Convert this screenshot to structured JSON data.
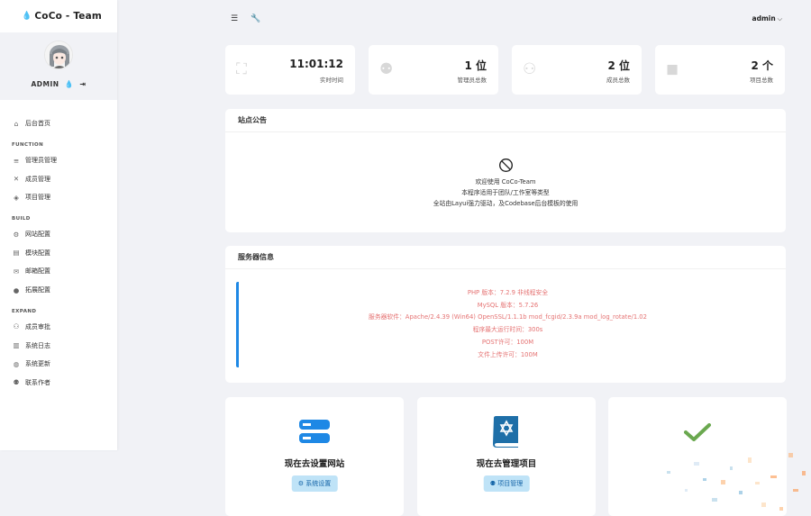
{
  "brand": {
    "title": "CoCo - Team"
  },
  "user": {
    "name": "ADMIN"
  },
  "topbar": {
    "admin_label": "admin"
  },
  "sidebar": {
    "home": "后台首页",
    "sections": [
      {
        "title": "FUNCTION",
        "items": [
          "管理员管理",
          "成员管理",
          "项目管理"
        ]
      },
      {
        "title": "BUILD",
        "items": [
          "网站配置",
          "模块配置",
          "邮箱配置",
          "拓展配置"
        ]
      },
      {
        "title": "EXPAND",
        "items": [
          "成员审批",
          "系统日志",
          "系统更新",
          "联系作者"
        ]
      }
    ]
  },
  "stats": [
    {
      "value": "11:01:12",
      "label": "实时时间",
      "icon": "sitemap-icon"
    },
    {
      "value": "1 位",
      "label": "管理员总数",
      "icon": "users-icon"
    },
    {
      "value": "2 位",
      "label": "成员总数",
      "icon": "group-icon"
    },
    {
      "value": "2 个",
      "label": "项目总数",
      "icon": "bag-icon"
    }
  ],
  "notice": {
    "title": "站点公告",
    "lines": [
      "欢迎使用 CoCo-Team",
      "本程序适用于团队/工作室等类型",
      "全站由Layui强力驱动，及Codebase后台模板的使用"
    ]
  },
  "server": {
    "title": "服务器信息",
    "lines": [
      "PHP 版本：7.2.9 非线程安全",
      "MySQL 版本：5.7.26",
      "服务器软件：Apache/2.4.39 (Win64) OpenSSL/1.1.1b mod_fcgid/2.3.9a mod_log_rotate/1.02",
      "程序最大运行时间：300s",
      "POST许可：100M",
      "文件上传许可：100M"
    ]
  },
  "cards": [
    {
      "title": "现在去设置网站",
      "button": "系统设置"
    },
    {
      "title": "现在去管理项目",
      "button": "项目管理"
    }
  ],
  "colors": {
    "accent": "#1e88e5",
    "server_text": "#e57373",
    "check": "#6aa84f"
  }
}
